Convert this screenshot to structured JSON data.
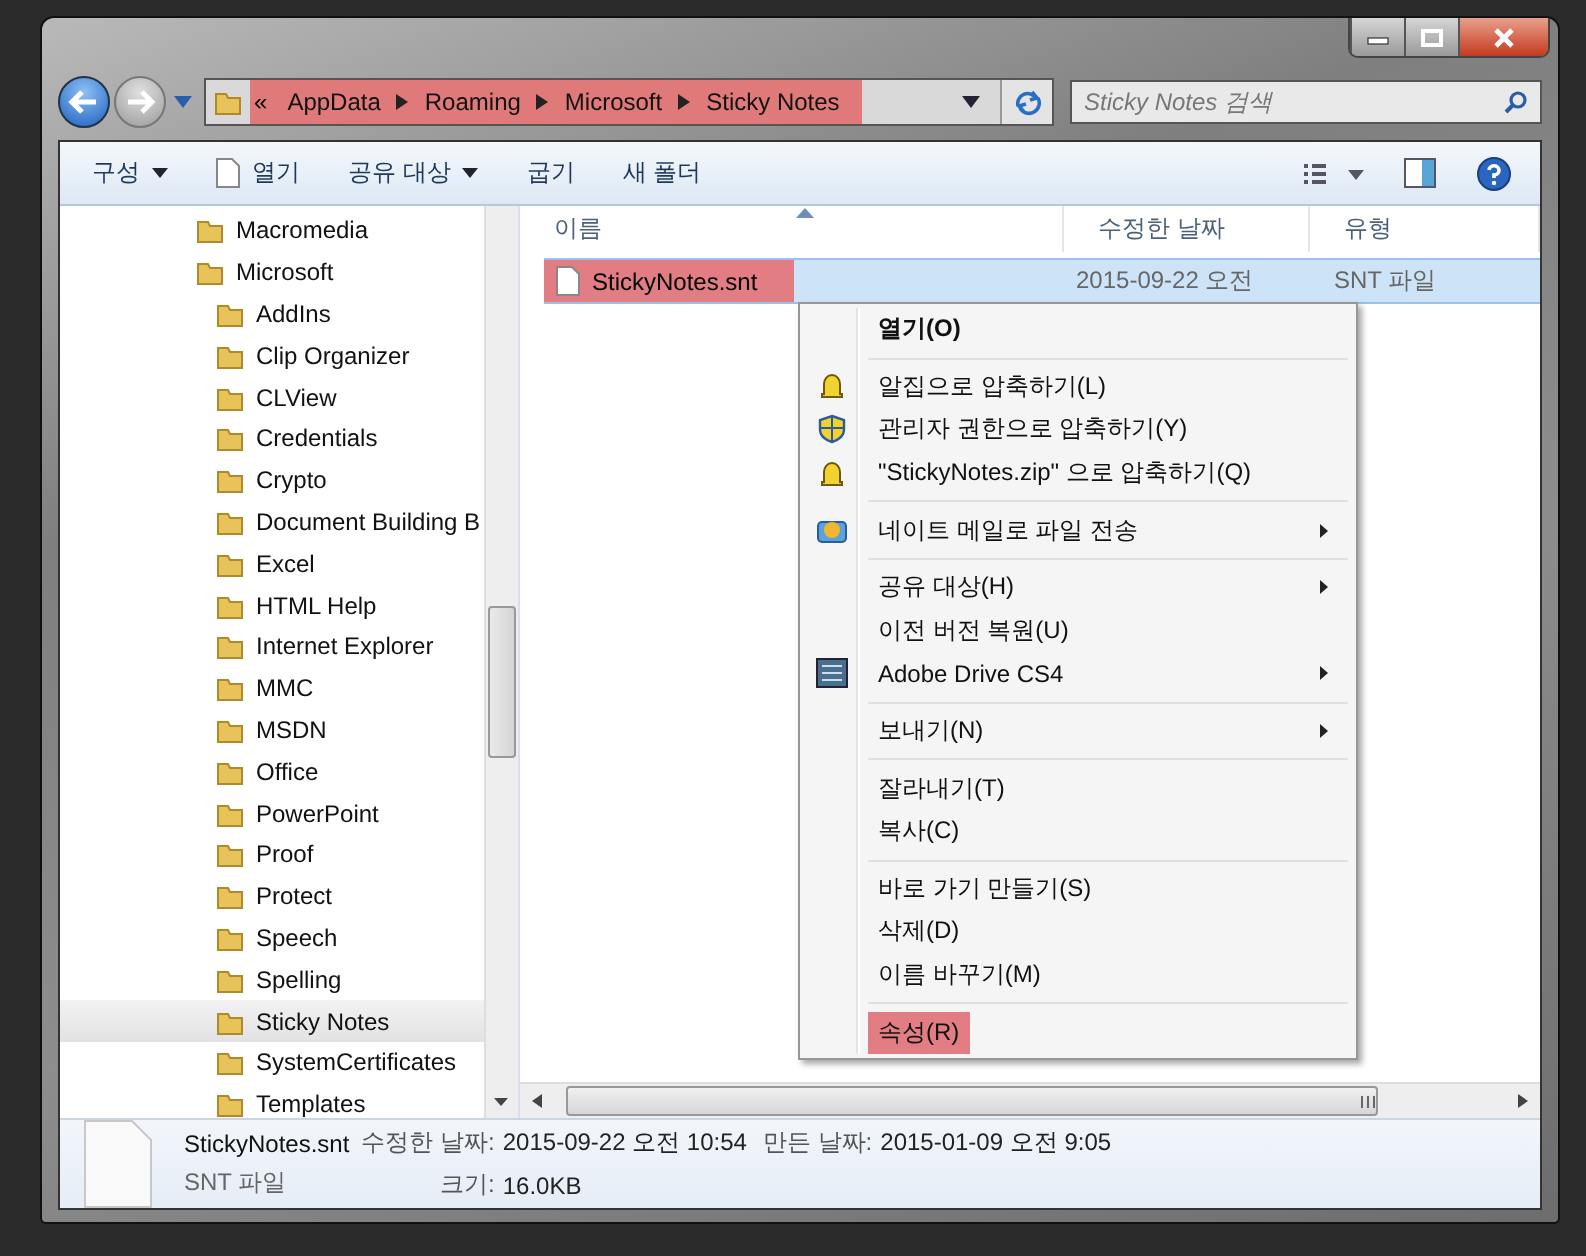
{
  "address": {
    "overflow": "«",
    "highlighted": true,
    "crumbs": [
      "AppData",
      "Roaming",
      "Microsoft",
      "Sticky Notes"
    ]
  },
  "search": {
    "placeholder": "Sticky Notes 검색"
  },
  "toolbar": [
    {
      "label": "구성",
      "kind": "menu"
    },
    {
      "label": "열기",
      "kind": "open"
    },
    {
      "label": "공유 대상",
      "kind": "menu"
    },
    {
      "label": "굽기",
      "kind": "button"
    },
    {
      "label": "새 폴더",
      "kind": "button"
    }
  ],
  "tree": [
    {
      "label": "Macromedia",
      "selected": false
    },
    {
      "label": "Microsoft",
      "selected": false,
      "children": [
        {
          "label": "AddIns",
          "selected": false
        },
        {
          "label": "Clip Organizer",
          "selected": false
        },
        {
          "label": "CLView",
          "selected": false
        },
        {
          "label": "Credentials",
          "selected": false
        },
        {
          "label": "Crypto",
          "selected": false
        },
        {
          "label": "Document Building B",
          "selected": false
        },
        {
          "label": "Excel",
          "selected": false
        },
        {
          "label": "HTML Help",
          "selected": false
        },
        {
          "label": "Internet Explorer",
          "selected": false
        },
        {
          "label": "MMC",
          "selected": false
        },
        {
          "label": "MSDN",
          "selected": false
        },
        {
          "label": "Office",
          "selected": false
        },
        {
          "label": "PowerPoint",
          "selected": false
        },
        {
          "label": "Proof",
          "selected": false
        },
        {
          "label": "Protect",
          "selected": false
        },
        {
          "label": "Speech",
          "selected": false
        },
        {
          "label": "Spelling",
          "selected": false
        },
        {
          "label": "Sticky Notes",
          "selected": true
        },
        {
          "label": "SystemCertificates",
          "selected": false
        },
        {
          "label": "Templates",
          "selected": false
        }
      ]
    }
  ],
  "columns": [
    "이름",
    "수정한 날짜",
    "유형"
  ],
  "files": [
    {
      "name": "StickyNotes.snt",
      "date": "2015-09-22 오전",
      "type": "SNT 파일",
      "selected": true,
      "highlighted": true
    }
  ],
  "context_menu": [
    {
      "kind": "default",
      "label": "열기(O)",
      "submenu": false,
      "highlighted": false
    },
    {
      "kind": "separator"
    },
    {
      "kind": "zip",
      "label": "알집으로 압축하기(L)",
      "submenu": false,
      "highlighted": false
    },
    {
      "kind": "admin_zip",
      "label": "관리자 권한으로 압축하기(Y)",
      "submenu": false,
      "highlighted": false
    },
    {
      "kind": "zip",
      "label": "\"StickyNotes.zip\" 으로 압축하기(Q)",
      "submenu": false,
      "highlighted": false
    },
    {
      "kind": "separator"
    },
    {
      "kind": "mail",
      "label": "네이트 메일로 파일 전송",
      "submenu": true,
      "highlighted": false
    },
    {
      "kind": "separator"
    },
    {
      "kind": "plain",
      "label": "공유 대상(H)",
      "submenu": true,
      "highlighted": false
    },
    {
      "kind": "plain",
      "label": "이전 버전 복원(U)",
      "submenu": false,
      "highlighted": false
    },
    {
      "kind": "drive",
      "label": "Adobe Drive CS4",
      "submenu": true,
      "highlighted": false
    },
    {
      "kind": "separator"
    },
    {
      "kind": "plain",
      "label": "보내기(N)",
      "submenu": true,
      "highlighted": false
    },
    {
      "kind": "separator"
    },
    {
      "kind": "plain",
      "label": "잘라내기(T)",
      "submenu": false,
      "highlighted": false
    },
    {
      "kind": "plain",
      "label": "복사(C)",
      "submenu": false,
      "highlighted": false
    },
    {
      "kind": "separator"
    },
    {
      "kind": "plain",
      "label": "바로 가기 만들기(S)",
      "submenu": false,
      "highlighted": false
    },
    {
      "kind": "plain",
      "label": "삭제(D)",
      "submenu": false,
      "highlighted": false
    },
    {
      "kind": "plain",
      "label": "이름 바꾸기(M)",
      "submenu": false,
      "highlighted": false
    },
    {
      "kind": "separator"
    },
    {
      "kind": "plain",
      "label": "속성(R)",
      "submenu": false,
      "highlighted": true
    }
  ],
  "details": {
    "name": "StickyNotes.snt",
    "type": "SNT 파일",
    "fields": [
      {
        "label": "수정한 날짜:",
        "value": "2015-09-22 오전 10:54"
      },
      {
        "label": "만든 날짜:",
        "value": "2015-01-09 오전 9:05"
      },
      {
        "label": "크기:",
        "value": "16.0KB"
      }
    ]
  }
}
